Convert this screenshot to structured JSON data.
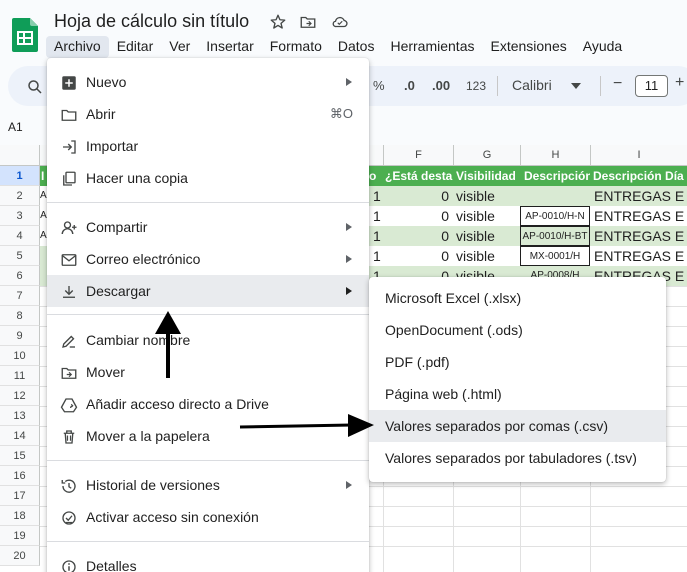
{
  "app": {
    "title": "Hoja de cálculo sin título"
  },
  "menubar": [
    "Archivo",
    "Editar",
    "Ver",
    "Insertar",
    "Formato",
    "Datos",
    "Herramientas",
    "Extensiones",
    "Ayuda"
  ],
  "toolbar": {
    "percent": "%",
    "decimal_decrease": ".0",
    "decimal_increase": ".00",
    "number_format": "123",
    "font": "Calibri",
    "font_size": "11",
    "minus": "−",
    "plus": "+"
  },
  "name_box": "A1",
  "columns": [
    "F",
    "G",
    "H",
    "I"
  ],
  "rows": [
    "1",
    "2",
    "3",
    "4",
    "5",
    "6",
    "7",
    "8",
    "9",
    "10",
    "11",
    "12",
    "13",
    "14",
    "15",
    "16",
    "17",
    "18",
    "19",
    "20"
  ],
  "sheet": {
    "headers": {
      "left": "I",
      "e_partial": "o",
      "f": "¿Está desta",
      "g": "Visibilidad",
      "h": "Descripción",
      "i": "Descripción Día"
    },
    "left_cells": [
      "AF",
      "A",
      "AF",
      "",
      ""
    ],
    "rows": [
      {
        "e": "1",
        "f": "0",
        "g": "visible",
        "h": "",
        "i": "ENTREGAS E"
      },
      {
        "e": "1",
        "f": "0",
        "g": "visible",
        "h": "AP-0010/H-N",
        "i": "ENTREGAS E"
      },
      {
        "e": "1",
        "f": "0",
        "g": "visible",
        "h": "AP-0010/H-BT",
        "i": "ENTREGAS E"
      },
      {
        "e": "1",
        "f": "0",
        "g": "visible",
        "h": "MX-0001/H",
        "i": "ENTREGAS E"
      },
      {
        "e": "1",
        "f": "0",
        "g": "visible",
        "h": "AP-0008/H",
        "i": "ENTREGAS E"
      }
    ]
  },
  "file_menu": {
    "items": [
      {
        "label": "Nuevo",
        "icon": "plus-box-icon",
        "submenu": true
      },
      {
        "label": "Abrir",
        "icon": "folder-icon",
        "shortcut": "⌘O"
      },
      {
        "label": "Importar",
        "icon": "import-icon"
      },
      {
        "label": "Hacer una copia",
        "icon": "copy-icon"
      },
      {
        "label": "Compartir",
        "icon": "person-add-icon",
        "submenu": true
      },
      {
        "label": "Correo electrónico",
        "icon": "mail-icon",
        "submenu": true
      },
      {
        "label": "Descargar",
        "icon": "download-icon",
        "submenu": true
      },
      {
        "label": "Cambiar nombre",
        "icon": "rename-icon"
      },
      {
        "label": "Mover",
        "icon": "move-folder-icon"
      },
      {
        "label": "Añadir acceso directo a Drive",
        "icon": "drive-shortcut-icon"
      },
      {
        "label": "Mover a la papelera",
        "icon": "trash-icon"
      },
      {
        "label": "Historial de versiones",
        "icon": "history-icon",
        "submenu": true
      },
      {
        "label": "Activar acceso sin conexión",
        "icon": "offline-icon"
      },
      {
        "label": "Detalles",
        "icon": "info-icon"
      }
    ]
  },
  "download_menu": {
    "items": [
      "Microsoft Excel (.xlsx)",
      "OpenDocument (.ods)",
      "PDF (.pdf)",
      "Página web (.html)",
      "Valores separados por comas (.csv)",
      "Valores separados por tabuladores (.tsv)"
    ]
  },
  "colors": {
    "header_green": "#4caf50",
    "light_green": "#d9ead3",
    "hover": "#e9ebee"
  }
}
